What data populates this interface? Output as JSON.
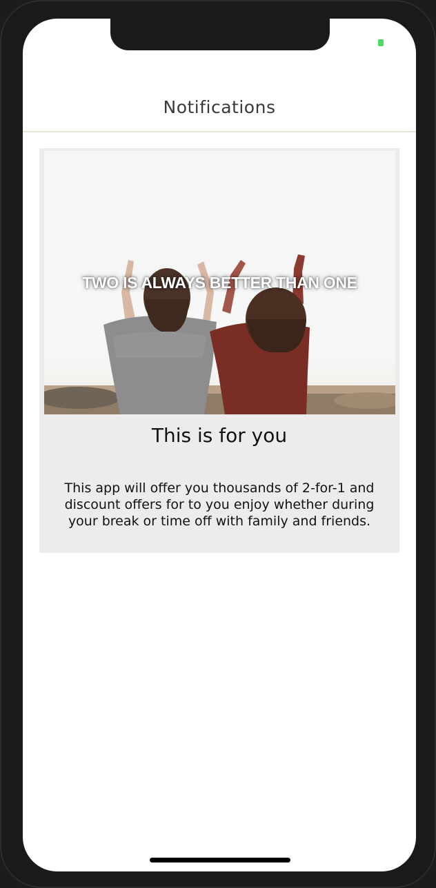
{
  "navbar": {
    "title": "Notifications"
  },
  "card": {
    "image_text": "TWO IS ALWAYS BETTER THAN ONE",
    "title": "This is for you",
    "body": "This app will offer you thousands of 2-for-1 and discount offers for to you enjoy whether during your break or time off with family and friends."
  },
  "colors": {
    "screen_bg": "#ffffff",
    "card_bg": "#ececec",
    "battery": "#4cd964",
    "navbar_divider": "#e6e3d8"
  }
}
